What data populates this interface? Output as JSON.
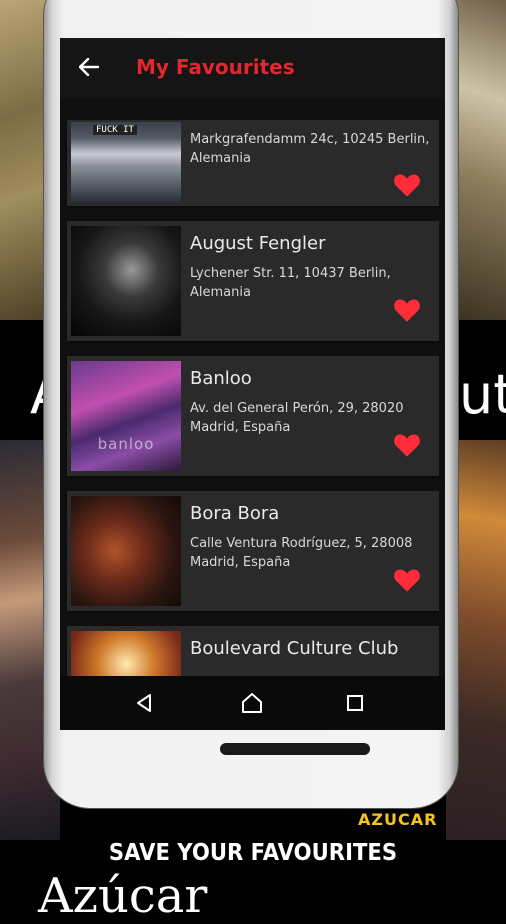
{
  "promo": {
    "tagline": "SAVE YOUR FAVOURITES",
    "bottom_word": "Azúcar",
    "mid_left": "A",
    "mid_right": "ut",
    "sign_text": "AZUCAR"
  },
  "appbar": {
    "title": "My Favourites",
    "back_icon": "arrow-left-icon"
  },
  "favourites": [
    {
      "name": "",
      "address": "Markgrafendamm 24c, 10245 Berlin, Alemania",
      "thumb_text": "FUCK IT",
      "favourited": true
    },
    {
      "name": "August Fengler",
      "address": "Lychener Str. 11, 10437 Berlin, Alemania",
      "favourited": true
    },
    {
      "name": "Banloo",
      "address": "Av. del General Perón, 29, 28020 Madrid, España",
      "thumb_text": "banloo",
      "favourited": true
    },
    {
      "name": "Bora Bora",
      "address": "Calle Ventura Rodríguez, 5, 28008 Madrid, España",
      "favourited": true
    },
    {
      "name": "Boulevard Culture Club",
      "address": "",
      "favourited": true
    }
  ],
  "colors": {
    "accent": "#e3262f",
    "heart": "#ff2d3a",
    "card": "#2a2a2a",
    "appbar": "#151515"
  },
  "navbar": {
    "back_icon": "triangle-back-icon",
    "home_icon": "circle-home-icon",
    "recents_icon": "square-recents-icon"
  }
}
